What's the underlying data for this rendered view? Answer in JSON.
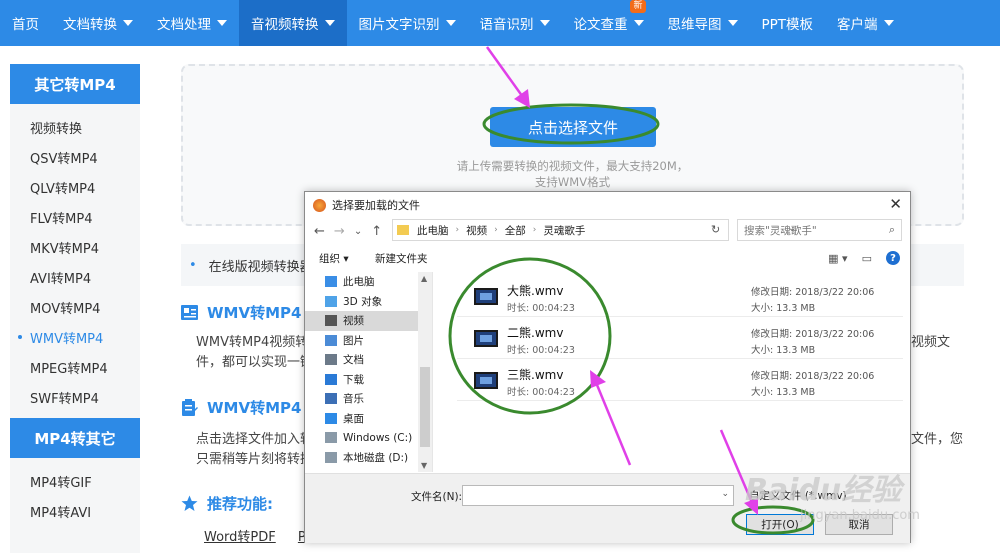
{
  "nav": {
    "items": [
      {
        "label": "首页",
        "caret": false
      },
      {
        "label": "文档转换",
        "caret": true
      },
      {
        "label": "文档处理",
        "caret": true
      },
      {
        "label": "音视频转换",
        "caret": true,
        "active": true
      },
      {
        "label": "图片文字识别",
        "caret": true
      },
      {
        "label": "语音识别",
        "caret": true
      },
      {
        "label": "论文查重",
        "caret": true,
        "badge": "新"
      },
      {
        "label": "思维导图",
        "caret": true
      },
      {
        "label": "PPT模板",
        "caret": false
      },
      {
        "label": "客户端",
        "caret": true
      }
    ]
  },
  "sidebar": {
    "section1_title": "其它转MP4",
    "section1_items": [
      "视频转换",
      "QSV转MP4",
      "QLV转MP4",
      "FLV转MP4",
      "MKV转MP4",
      "AVI转MP4",
      "MOV转MP4",
      "WMV转MP4",
      "MPEG转MP4",
      "SWF转MP4"
    ],
    "active_item": "WMV转MP4",
    "section2_title": "MP4转其它",
    "section2_items": [
      "MP4转GIF",
      "MP4转AVI"
    ]
  },
  "upload": {
    "button_label": "点击选择文件",
    "hint_line1": "请上传需要转换的视频文件，最大支持20M，",
    "hint_line2": "支持WMV格式"
  },
  "notice": {
    "text": "在线版视频转换器"
  },
  "content": {
    "section1_title": "WMV转MP4 i",
    "section1_text_line1": "WMV转MP4视频转",
    "section1_text_line2": "件，都可以实现一键",
    "section1_text_right_line1": "视频文",
    "section2_title": "WMV转MP4 l",
    "section2_text_line1": "点击选择文件加入转",
    "section2_text_line2": "只需稍等片刻将转换",
    "section2_text_right_line1": "文件，您",
    "section3_title": "推荐功能:",
    "links": [
      "Word转PDF",
      "P"
    ]
  },
  "dialog": {
    "title": "选择要加载的文件",
    "close": "✕",
    "back": "←",
    "forward": "→",
    "dropdown": "⌄",
    "up": "↑",
    "path": [
      "此电脑",
      "视频",
      "全部",
      "灵魂歌手"
    ],
    "refresh": "↻",
    "search_placeholder": "搜索\"灵魂歌手\"",
    "organize": "组织 ▾",
    "new_folder": "新建文件夹",
    "help": "?",
    "tree": [
      {
        "label": "此电脑",
        "icon": "computer-icon",
        "color": "#3a8ee6"
      },
      {
        "label": "3D 对象",
        "icon": "cube-icon",
        "color": "#4fa3e8"
      },
      {
        "label": "视频",
        "icon": "video-folder-icon",
        "color": "#555555",
        "selected": true
      },
      {
        "label": "图片",
        "icon": "picture-folder-icon",
        "color": "#4b8bd6"
      },
      {
        "label": "文档",
        "icon": "document-folder-icon",
        "color": "#6c7a89"
      },
      {
        "label": "下载",
        "icon": "download-icon",
        "color": "#2a7ad6"
      },
      {
        "label": "音乐",
        "icon": "music-icon",
        "color": "#3c6fb5"
      },
      {
        "label": "桌面",
        "icon": "desktop-icon",
        "color": "#2d8ae6"
      },
      {
        "label": "Windows (C:)",
        "icon": "drive-c-icon",
        "color": "#8a9aa8"
      },
      {
        "label": "本地磁盘 (D:)",
        "icon": "drive-d-icon",
        "color": "#8a9aa8"
      }
    ],
    "files": [
      {
        "name": "大熊.wmv",
        "duration": "时长: 00:04:23",
        "modified": "修改日期: 2018/3/22 20:06",
        "size": "大小: 13.3 MB"
      },
      {
        "name": "二熊.wmv",
        "duration": "时长: 00:04:23",
        "modified": "修改日期: 2018/3/22 20:06",
        "size": "大小: 13.3 MB"
      },
      {
        "name": "三熊.wmv",
        "duration": "时长: 00:04:23",
        "modified": "修改日期: 2018/3/22 20:06",
        "size": "大小: 13.3 MB"
      }
    ],
    "filename_label": "文件名(N):",
    "filename_value": "",
    "filetype_label": "自定义文件 (*.wmv)",
    "open_button": "打开(O)",
    "cancel_button": "取消"
  },
  "watermark": {
    "text": "Baidu经验",
    "subtext": "jingyan.baidu.com"
  },
  "colors": {
    "brand": "#2d8ae6",
    "annotation_green": "#3a8a2e",
    "annotation_arrow": "#e040e8"
  }
}
